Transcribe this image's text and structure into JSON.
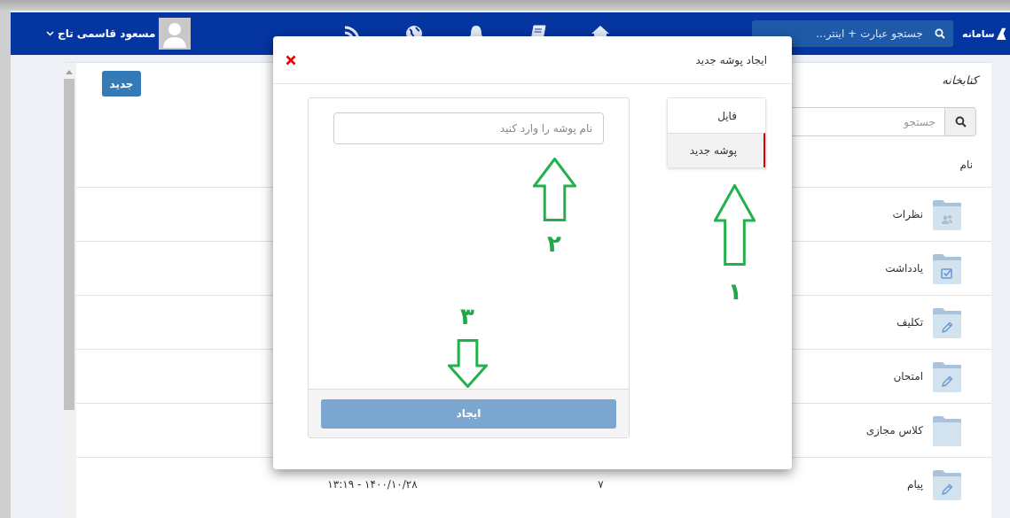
{
  "navbar": {
    "logo": "سامانه",
    "search": {
      "placeholder": "جستجو عبارت + اینتر..."
    },
    "user": {
      "name": "مسعود قاسمی تاج"
    }
  },
  "library": {
    "title": "کتابخانه",
    "new_button": "جدید",
    "search": {
      "placeholder": "جستجو"
    },
    "columns": [
      "نام"
    ],
    "rows": [
      {
        "name": "نظرات",
        "kind": "people"
      },
      {
        "name": "یادداشت",
        "kind": "check"
      },
      {
        "name": "تکلیف",
        "kind": "pencil"
      },
      {
        "name": "امتحان",
        "kind": "pencil"
      },
      {
        "name": "کلاس مجازی",
        "kind": "plain"
      },
      {
        "name": "پیام",
        "kind": "pencil",
        "size": "۷",
        "modified": "۱۴۰۰/۱۰/۲۸ - ۱۳:۱۹"
      }
    ]
  },
  "dialog": {
    "title": "ایجاد پوشه جدید",
    "tabs": [
      {
        "label": "فایل",
        "selected": false
      },
      {
        "label": "پوشه جدید",
        "selected": true
      }
    ],
    "folder_name": {
      "placeholder": "نام پوشه را وارد کنید"
    },
    "create_button": {
      "label": "ایجاد",
      "disabled": true
    }
  },
  "annotations": [
    {
      "number": "۱",
      "points_down": false
    },
    {
      "number": "۲",
      "points_down": false
    },
    {
      "number": "۳",
      "points_down": true
    }
  ]
}
